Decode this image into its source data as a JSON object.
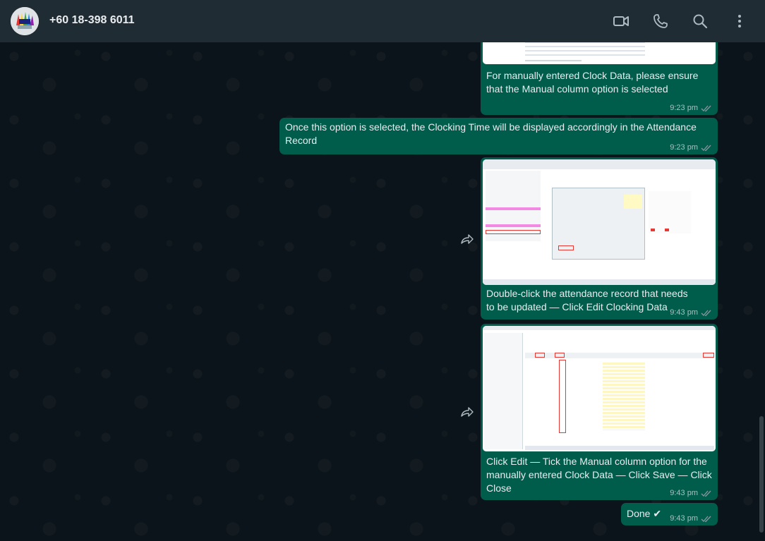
{
  "header": {
    "contact_name": "+60 18-398 6011",
    "icons": [
      "video-call-icon",
      "voice-call-icon",
      "search-icon",
      "menu-icon"
    ]
  },
  "messages": [
    {
      "text": "For manually entered Clock Data, please ensure that the Manual column option is selected",
      "time": "9:23 pm",
      "has_image": true
    },
    {
      "text": "Once this option is selected, the Clocking Time will be displayed accordingly in the Attendance Record",
      "time": "9:23 pm",
      "has_image": false
    },
    {
      "text": "Double-click the attendance record that needs to be updated — Click Edit Clocking Data",
      "time": "9:43 pm",
      "has_image": true
    },
    {
      "text": "Click Edit — Tick the Manual column option for the manually entered Clock Data — Click Save — Click Close",
      "time": "9:43 pm",
      "has_image": true
    },
    {
      "text": "Done ✔",
      "time": "9:43 pm",
      "has_image": false
    }
  ],
  "colors": {
    "bubble": "#005c4b",
    "header": "#202c33",
    "background": "#0b141a",
    "read_ticks": "#8696a0"
  }
}
